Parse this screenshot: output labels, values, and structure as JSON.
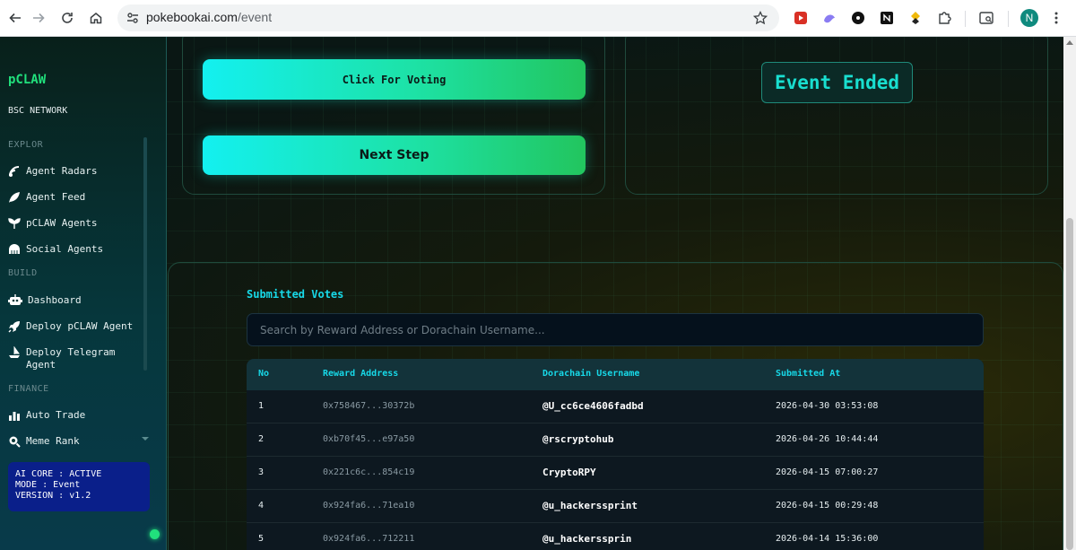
{
  "browser": {
    "url_host": "pokebookai.com",
    "url_path": "/event",
    "profile_initial": "N",
    "icons": [
      "back-icon",
      "forward-icon",
      "reload-icon",
      "home-icon",
      "site-info-icon",
      "bookmark-star-icon",
      "extension-icons",
      "extensions-puzzle-icon",
      "side-panel-icon",
      "profile-avatar"
    ]
  },
  "sidebar": {
    "brand": "pCLAW",
    "network": "BSC NETWORK",
    "sections": {
      "explore": "EXPLOR",
      "build": "BUILD",
      "finance": "FINANCE"
    },
    "explore_items": [
      {
        "label": "Agent Radars",
        "icon": "radar-icon"
      },
      {
        "label": "Agent Feed",
        "icon": "feed-leaf-icon"
      },
      {
        "label": "pCLAW Agents",
        "icon": "sprout-icon"
      },
      {
        "label": "Social Agents",
        "icon": "group-icon"
      }
    ],
    "build_items": [
      {
        "label": "Dashboard",
        "icon": "robot-icon"
      },
      {
        "label": "Deploy pCLAW Agent",
        "icon": "rocket-icon"
      },
      {
        "label": "Deploy Telegram Agent",
        "icon": "ship-icon"
      }
    ],
    "finance_items": [
      {
        "label": "Auto Trade",
        "icon": "chart-bars-icon"
      },
      {
        "label": "Meme Rank",
        "icon": "search-coin-icon"
      }
    ],
    "status": {
      "line1": "AI CORE : ACTIVE",
      "line2": "MODE : Event",
      "line3": "VERSION : v1.2"
    }
  },
  "main": {
    "vote_button": "Click For Voting",
    "next_button": "Next Step",
    "event_status": "Event Ended",
    "votes_title": "Submitted Votes",
    "search_placeholder": "Search by Reward Address or Dorachain Username...",
    "columns": [
      "No",
      "Reward Address",
      "Dorachain Username",
      "Submitted At"
    ],
    "rows": [
      {
        "no": "1",
        "address": "0x758467...30372b",
        "username": "@U_cc6ce4606fadbd",
        "submitted_at": "2026-04-30 03:53:08"
      },
      {
        "no": "2",
        "address": "0xb70f45...e97a50",
        "username": "@rscryptohub",
        "submitted_at": "2026-04-26 10:44:44"
      },
      {
        "no": "3",
        "address": "0x221c6c...854c19",
        "username": "CryptoRPY",
        "submitted_at": "2026-04-15 07:00:27"
      },
      {
        "no": "4",
        "address": "0x924fa6...71ea10",
        "username": "@u_hackerssprint",
        "submitted_at": "2026-04-15 00:29:48"
      },
      {
        "no": "5",
        "address": "0x924fa6...712211",
        "username": "@u_hackerssprin",
        "submitted_at": "2026-04-14 15:36:00"
      }
    ]
  },
  "colors": {
    "brand_green": "#21e07c",
    "accent_cyan": "#17d9e8",
    "button_gradient_start": "#13f0f0",
    "button_gradient_end": "#22c55e",
    "status_box": "#0a1f8a"
  }
}
